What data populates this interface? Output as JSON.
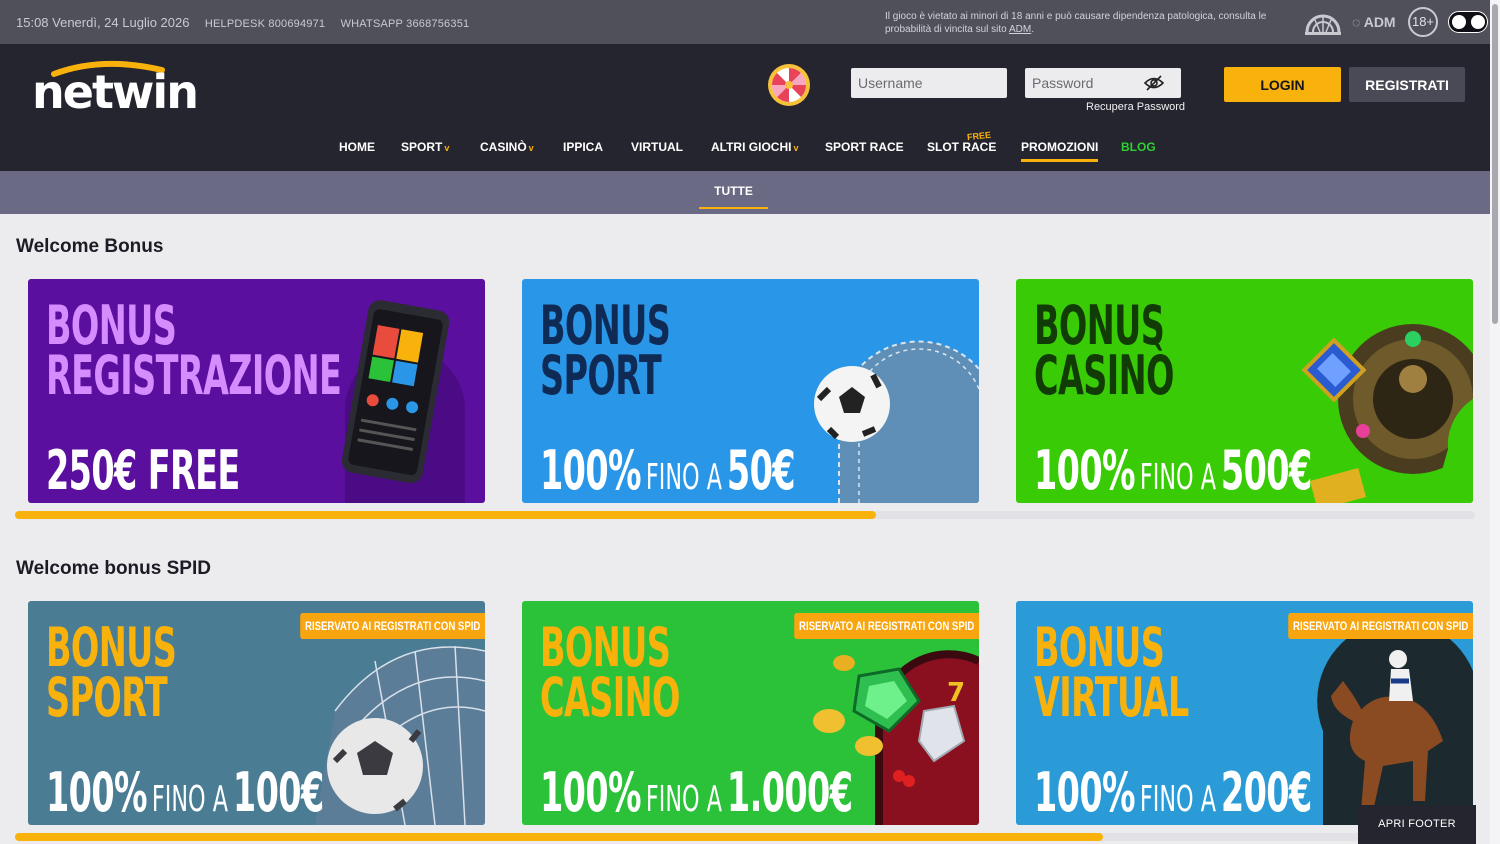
{
  "topbar": {
    "datetime": "15:08 Venerdì, 24 Luglio 2026",
    "helpdesk": "HELPDESK 800694971",
    "whatsapp": "WHATSAPP 3668756351",
    "disclaimer": "Il gioco è vietato ai minori di 18 anni e può causare dipendenza patologica, consulta le probabilità di vincita sul sito",
    "disclaimer_link": "ADM",
    "adm_label": "ADM",
    "age_label": "18+"
  },
  "header": {
    "logo_text": "netwin",
    "username_placeholder": "Username",
    "password_placeholder": "Password",
    "recover_password": "Recupera Password",
    "login_label": "LOGIN",
    "register_label": "REGISTRATI"
  },
  "nav": {
    "items": [
      {
        "label": "HOME",
        "dropdown": false
      },
      {
        "label": "SPORT",
        "dropdown": true
      },
      {
        "label": "CASINÒ",
        "dropdown": true
      },
      {
        "label": "IPPICA",
        "dropdown": false
      },
      {
        "label": "VIRTUAL",
        "dropdown": false
      },
      {
        "label": "ALTRI GIOCHI",
        "dropdown": true
      },
      {
        "label": "SPORT RACE",
        "dropdown": false
      },
      {
        "label": "SLOT RACE",
        "dropdown": false,
        "badge": "FREE"
      },
      {
        "label": "PROMOZIONI",
        "dropdown": false,
        "active": true
      },
      {
        "label": "BLOG",
        "dropdown": false,
        "color": "#2fcf34"
      }
    ],
    "chevron": "v"
  },
  "subnav": {
    "tabs": [
      {
        "label": "TUTTE",
        "active": true
      }
    ]
  },
  "sections": [
    {
      "title": "Welcome Bonus",
      "scroll_progress": 0.59,
      "cards": [
        {
          "line1": "BONUS",
          "line2": "REGISTRAZIONE",
          "offer": "250€ FREE",
          "bg": "#5b0f9e",
          "title_color": "#d58cff",
          "art": "phone-icon"
        },
        {
          "line1": "BONUS",
          "line2": "SPORT",
          "pct": "100%",
          "fino": "FINO A",
          "amount": "50€",
          "bg": "#2a96e8",
          "title_color": "#0f2a55",
          "art": "soccer-ball-icon"
        },
        {
          "line1": "BONUS",
          "line2": "CASINÒ",
          "pct": "100%",
          "fino": "FINO A",
          "amount": "500€",
          "bg": "#39cc06",
          "title_color": "#123c05",
          "art": "casino-gems-icon"
        }
      ]
    },
    {
      "title": "Welcome bonus SPID",
      "scroll_progress": 0.745,
      "cards": [
        {
          "line1": "BONUS",
          "line2": "SPORT",
          "pct": "100%",
          "fino": "FINO A",
          "amount": "100€",
          "tag": "RISERVATO AI REGISTRATI CON SPID",
          "bg": "#4a7c94",
          "title_color": "#f9b20c",
          "art": "soccer-ball-icon"
        },
        {
          "line1": "BONUS",
          "line2": "CASINO",
          "pct": "100%",
          "fino": "FINO A",
          "amount": "1.000€",
          "tag": "RISERVATO AI REGISTRATI CON SPID",
          "bg": "#2bc23a",
          "title_color": "#f9b20c",
          "art": "slot-symbols-icon"
        },
        {
          "line1": "BONUS",
          "line2": "VIRTUAL",
          "pct": "100%",
          "fino": "FINO A",
          "amount": "200€",
          "tag": "RISERVATO AI REGISTRATI CON SPID",
          "bg": "#2a9bd6",
          "title_color": "#f9b20c",
          "art": "racehorse-icon"
        }
      ]
    }
  ],
  "footer": {
    "open_footer": "APRI FOOTER"
  },
  "colors": {
    "accent": "#f9b20c",
    "header_bg": "#25252f",
    "topbar_bg": "#50505b",
    "subbar_bg": "#6b6a84",
    "page_bg": "#ececee"
  }
}
